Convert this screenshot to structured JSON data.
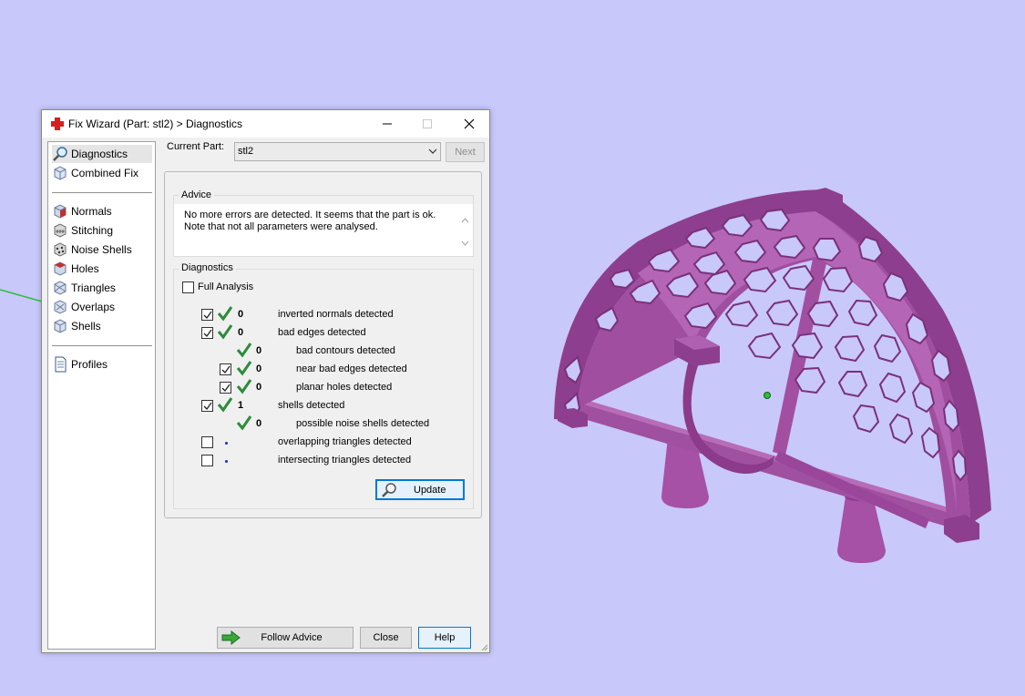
{
  "window": {
    "title": "Fix Wizard (Part: stl2) > Diagnostics",
    "controls": [
      "minimize",
      "maximize",
      "close"
    ]
  },
  "sidebar": {
    "items": [
      {
        "label": "Diagnostics",
        "icon": "magnifier-icon",
        "selected": true
      },
      {
        "label": "Combined Fix",
        "icon": "cube-icon"
      },
      {
        "label": "Normals",
        "icon": "red-face-cube-icon"
      },
      {
        "label": "Stitching",
        "icon": "stitch-cube-icon"
      },
      {
        "label": "Noise Shells",
        "icon": "noise-cube-icon"
      },
      {
        "label": "Holes",
        "icon": "hole-cube-icon"
      },
      {
        "label": "Triangles",
        "icon": "triangle-cube-icon"
      },
      {
        "label": "Overlaps",
        "icon": "overlap-cube-icon"
      },
      {
        "label": "Shells",
        "icon": "shells-cube-icon"
      },
      {
        "label": "Profiles",
        "icon": "document-icon"
      }
    ]
  },
  "current_part": {
    "label": "Current Part:",
    "value": "stl2",
    "next_label": "Next"
  },
  "advice": {
    "title": "Advice",
    "line1": "No more errors are detected. It seems that the part is ok.",
    "line2": "Note that not all parameters were analysed."
  },
  "diagnostics": {
    "title": "Diagnostics",
    "full_analysis_label": "Full Analysis",
    "full_analysis_checked": false,
    "rows": [
      {
        "label": "inverted normals detected",
        "count": "0",
        "checked": true,
        "status": "ok"
      },
      {
        "label": "bad edges detected",
        "count": "0",
        "checked": true,
        "status": "ok"
      },
      {
        "label": "bad contours detected",
        "count": "0",
        "status": "ok"
      },
      {
        "label": "near bad edges detected",
        "count": "0",
        "checked": true,
        "status": "ok"
      },
      {
        "label": "planar holes detected",
        "count": "0",
        "checked": true,
        "status": "ok"
      },
      {
        "label": "shells detected",
        "count": "1",
        "checked": true,
        "status": "ok"
      },
      {
        "label": "possible noise shells detected",
        "count": "0",
        "status": "ok"
      },
      {
        "label": "overlapping triangles detected",
        "checked": false,
        "status": "not-analysed"
      },
      {
        "label": "intersecting triangles detected",
        "checked": false,
        "status": "not-analysed"
      }
    ],
    "update_label": "Update"
  },
  "footer": {
    "follow_advice_label": "Follow Advice",
    "close_label": "Close",
    "help_label": "Help"
  },
  "colors": {
    "viewport_bg": "#c8c8fb",
    "model": "#9b3f9a",
    "tick_green": "#2e8b3a",
    "focus_blue": "#0078d7"
  }
}
